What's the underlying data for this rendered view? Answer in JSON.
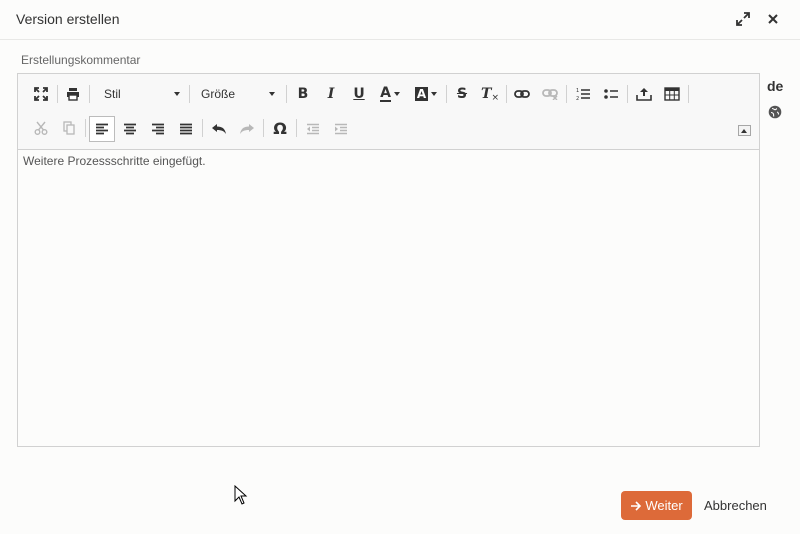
{
  "dialog": {
    "title": "Version erstellen"
  },
  "field": {
    "label": "Erstellungskommentar"
  },
  "editor": {
    "toolbar": {
      "style_combo": "Stil",
      "size_combo": "Größe",
      "bold": "B",
      "italic": "I",
      "underline": "U",
      "text_color": "A",
      "bg_color": "A",
      "strike": "S",
      "remove_format": "T",
      "special_char": "Ω"
    },
    "content": "Weitere Prozessschritte eingefügt."
  },
  "language": "de",
  "actions": {
    "continue_label": "Weiter",
    "cancel_label": "Abbrechen"
  },
  "colors": {
    "accent": "#dd6a39"
  },
  "icons": [
    "maximize-icon",
    "close-icon",
    "globe-icon",
    "arrow-right-icon"
  ]
}
